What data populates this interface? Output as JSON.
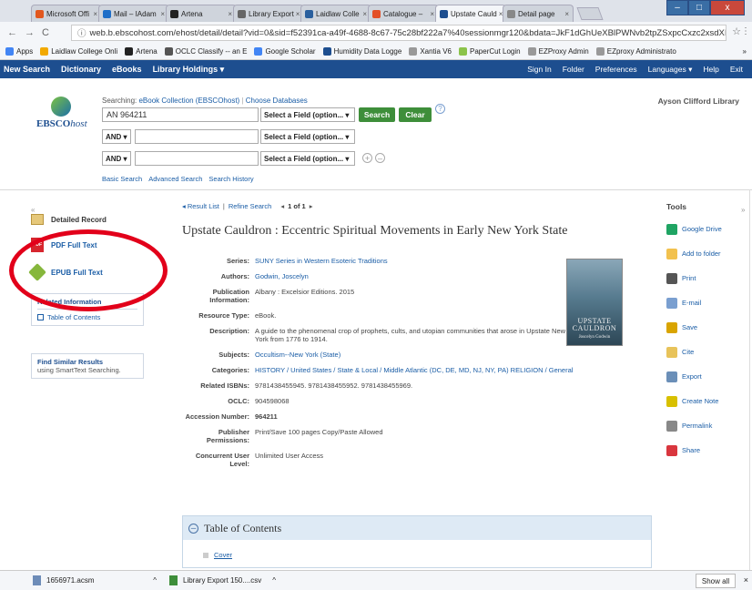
{
  "browser_tabs": [
    {
      "label": "Microsoft Offi",
      "color": "#e2571e",
      "close": "×"
    },
    {
      "label": "Mail – IAdam",
      "color": "#1e6ec8",
      "close": "×"
    },
    {
      "label": "Artena",
      "color": "#222222",
      "close": "×"
    },
    {
      "label": "Library Export",
      "color": "#666666",
      "close": "×"
    },
    {
      "label": "Laidlaw Colle",
      "color": "#2a5f9e",
      "close": "×"
    },
    {
      "label": "Catalogue –",
      "color": "#e34f26",
      "close": "×"
    },
    {
      "label": "Upstate Cauld",
      "color": "#1d4e8f",
      "close": "×",
      "active": true
    },
    {
      "label": "Detail page",
      "color": "#888888",
      "close": "×"
    }
  ],
  "window_buttons": {
    "minimize": "–",
    "maximize": "□",
    "close": "x"
  },
  "address_bar": {
    "back": "←",
    "forward": "→",
    "reload": "C",
    "url": "web.b.ebscohost.com/ehost/detail/detail?vid=0&sid=f52391ca-a49f-4688-8c67-75c28bf222a7%40sessionmgr120&bdata=JkF1dGhUeXBlPWNvb2tpZSxpcCxzc2xsdXIsLHVpZC...",
    "info": "ⓘ",
    "star": "☆",
    "menu": "⋮"
  },
  "bookmarks": [
    {
      "label": "Apps",
      "color": "#4285f4"
    },
    {
      "label": "Laidlaw College Onli",
      "color": "#f2a900"
    },
    {
      "label": "Artena",
      "color": "#222222"
    },
    {
      "label": "OCLC Classify -- an E",
      "color": "#555555"
    },
    {
      "label": "Google Scholar",
      "color": "#4285f4"
    },
    {
      "label": "Humidity Data Logge",
      "color": "#1d4e8f"
    },
    {
      "label": "Xantia V6",
      "color": "#999999"
    },
    {
      "label": "PaperCut Login",
      "color": "#8bc34a"
    },
    {
      "label": "EZProxy Admin",
      "color": "#999999"
    },
    {
      "label": "EZproxy Administrato",
      "color": "#999999"
    }
  ],
  "bookmarks_more": "»",
  "ebsco_nav": {
    "left": [
      "New Search",
      "Dictionary",
      "eBooks",
      "Library Holdings ▾"
    ],
    "right": [
      "Sign In",
      "Folder",
      "Preferences",
      "Languages ▾",
      "Help",
      "Exit"
    ]
  },
  "search": {
    "logo_main": "EBSCO",
    "logo_sub": "host",
    "searching_label": "Searching:",
    "searching_db": "eBook Collection (EBSCOhost)",
    "choose_db": "Choose Databases",
    "query": "AN 964211",
    "field_select": "Select a Field (option... ▾",
    "bool1": "AND ▾",
    "bool2": "AND ▾",
    "search_btn": "Search",
    "clear_btn": "Clear",
    "help": "?",
    "plus": "+",
    "minus": "–",
    "links": [
      "Basic Search",
      "Advanced Search",
      "Search History"
    ],
    "library_name": "Ayson Clifford Library"
  },
  "left_panel": {
    "collapse": "«",
    "detailed_record": "Detailed Record",
    "pdf": "PDF Full Text",
    "epub": "EPUB Full Text",
    "related_title": "Related Information",
    "toc_link": "Table of Contents",
    "find_similar_title": "Find Similar Results",
    "find_similar_sub": "using SmartText Searching."
  },
  "breadcrumb": {
    "back": "◂ Result List",
    "refine": "Refine Search",
    "prev": "◂",
    "of": "1 of 1",
    "next": "▸"
  },
  "record": {
    "title": "Upstate Cauldron : Eccentric Spiritual Movements in Early New York State",
    "fields": [
      {
        "k": "Series:",
        "v": "SUNY Series in Western Esoteric Traditions",
        "link": true
      },
      {
        "k": "Authors:",
        "v": "Godwin, Joscelyn",
        "link": true
      },
      {
        "k": "Publication Information:",
        "v": "Albany : Excelsior Editions. 2015",
        "link": false
      },
      {
        "k": "Resource Type:",
        "v": "eBook.",
        "link": false
      },
      {
        "k": "Description:",
        "v": "A guide to the phenomenal crop of prophets, cults, and utopian communities that arose in Upstate New York from 1776 to 1914.",
        "link": false
      },
      {
        "k": "Subjects:",
        "v": "Occultism--New York (State)",
        "link": true
      },
      {
        "k": "Categories:",
        "v": "HISTORY / United States / State & Local / Middle Atlantic (DC, DE, MD, NJ, NY, PA) RELIGION / General",
        "link": true
      },
      {
        "k": "Related ISBNs:",
        "v": "9781438455945. 9781438455952. 9781438455969.",
        "link": false
      },
      {
        "k": "OCLC:",
        "v": "904598068",
        "link": false
      },
      {
        "k": "Accession Number:",
        "v": "964211",
        "link": false,
        "bold": true
      },
      {
        "k": "Publisher Permissions:",
        "v": "Print/Save 100 pages Copy/Paste Allowed",
        "link": false
      },
      {
        "k": "Concurrent User Level:",
        "v": "Unlimited User Access",
        "link": false
      }
    ],
    "cover_title": "UPSTATE CAULDRON",
    "cover_author": "Joscelyn Godwin"
  },
  "toc": {
    "heading": "Table of Contents",
    "toggle": "–",
    "first_item": "Cover"
  },
  "tools": {
    "heading": "Tools",
    "collapse": "»",
    "items": [
      {
        "label": "Google Drive",
        "color": "#1fa463"
      },
      {
        "label": "Add to folder",
        "color": "#f2c14e"
      },
      {
        "label": "Print",
        "color": "#555555"
      },
      {
        "label": "E-mail",
        "color": "#7a9fd0"
      },
      {
        "label": "Save",
        "color": "#d9a400"
      },
      {
        "label": "Cite",
        "color": "#e8c35a"
      },
      {
        "label": "Export",
        "color": "#6b8fb8"
      },
      {
        "label": "Create Note",
        "color": "#d8c000"
      },
      {
        "label": "Permalink",
        "color": "#888888"
      },
      {
        "label": "Share",
        "color": "#d9363e"
      }
    ]
  },
  "downloads": {
    "items": [
      {
        "label": "1656971.acsm",
        "caret": "^"
      },
      {
        "label": "Library Export 150....csv",
        "caret": "^"
      }
    ],
    "show_all": "Show all",
    "close": "×"
  }
}
